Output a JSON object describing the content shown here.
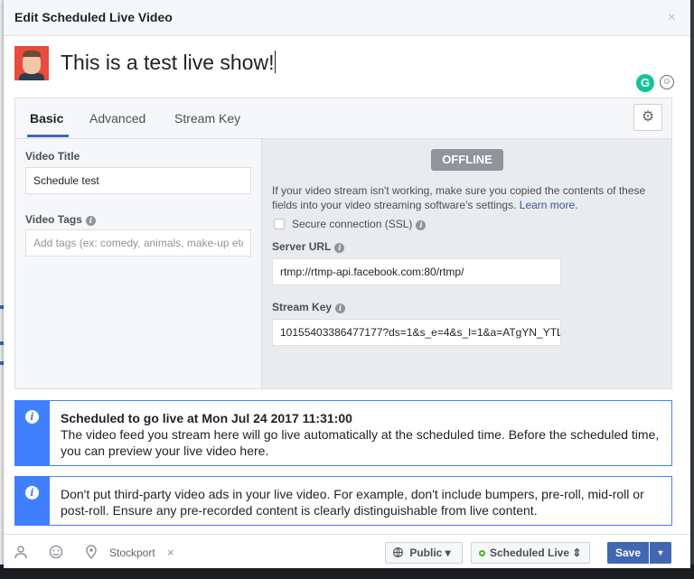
{
  "dialog": {
    "title": "Edit Scheduled Live Video",
    "close_label": "×",
    "post_text": "This is a test live show!"
  },
  "tabs": [
    {
      "label": "Basic",
      "active": true
    },
    {
      "label": "Advanced",
      "active": false
    },
    {
      "label": "Stream Key",
      "active": false
    }
  ],
  "left_form": {
    "video_title_label": "Video Title",
    "video_title_value": "Schedule test",
    "video_tags_label": "Video Tags",
    "video_tags_placeholder": "Add tags (ex: comedy, animals, make-up etc."
  },
  "stream": {
    "status": "OFFLINE",
    "help_text": "If your video stream isn't working, make sure you copied the contents of these fields into your video streaming software's settings.",
    "learn_more": "Learn more",
    "help_period": ".",
    "secure_label": "Secure connection (SSL)",
    "server_url_label": "Server URL",
    "server_url_value": "rtmp://rtmp-api.facebook.com:80/rtmp/",
    "stream_key_label": "Stream Key",
    "stream_key_value": "10155403386477177?ds=1&s_e=4&s_l=1&a=ATgYN_YTL"
  },
  "notices": {
    "scheduled_title": "Scheduled to go live at Mon Jul 24 2017 11:31:00",
    "scheduled_body": "The video feed you stream here will go live automatically at the scheduled time. Before the scheduled time, you can preview your live video here.",
    "ads_body": "Don't put third-party video ads in your live video. For example, don't include bumpers, pre-roll, mid-roll or post-roll. Ensure any pre-recorded content is clearly distinguishable from live content."
  },
  "footer": {
    "location": "Stockport",
    "location_remove": "×",
    "privacy": "Public ▾",
    "schedule": "Scheduled Live ⇕",
    "save": "Save",
    "save_dropdown": "▼"
  },
  "colors": {
    "accent": "#4267b2",
    "notice": "#4080ff",
    "offline_badge": "#90949c"
  },
  "icons": [
    "close-icon",
    "grammarly-icon",
    "emoji-icon",
    "gear-icon",
    "info-icon",
    "tag-people-icon",
    "feeling-icon",
    "location-pin-icon",
    "globe-icon",
    "status-dot-icon",
    "caret-down-icon"
  ]
}
